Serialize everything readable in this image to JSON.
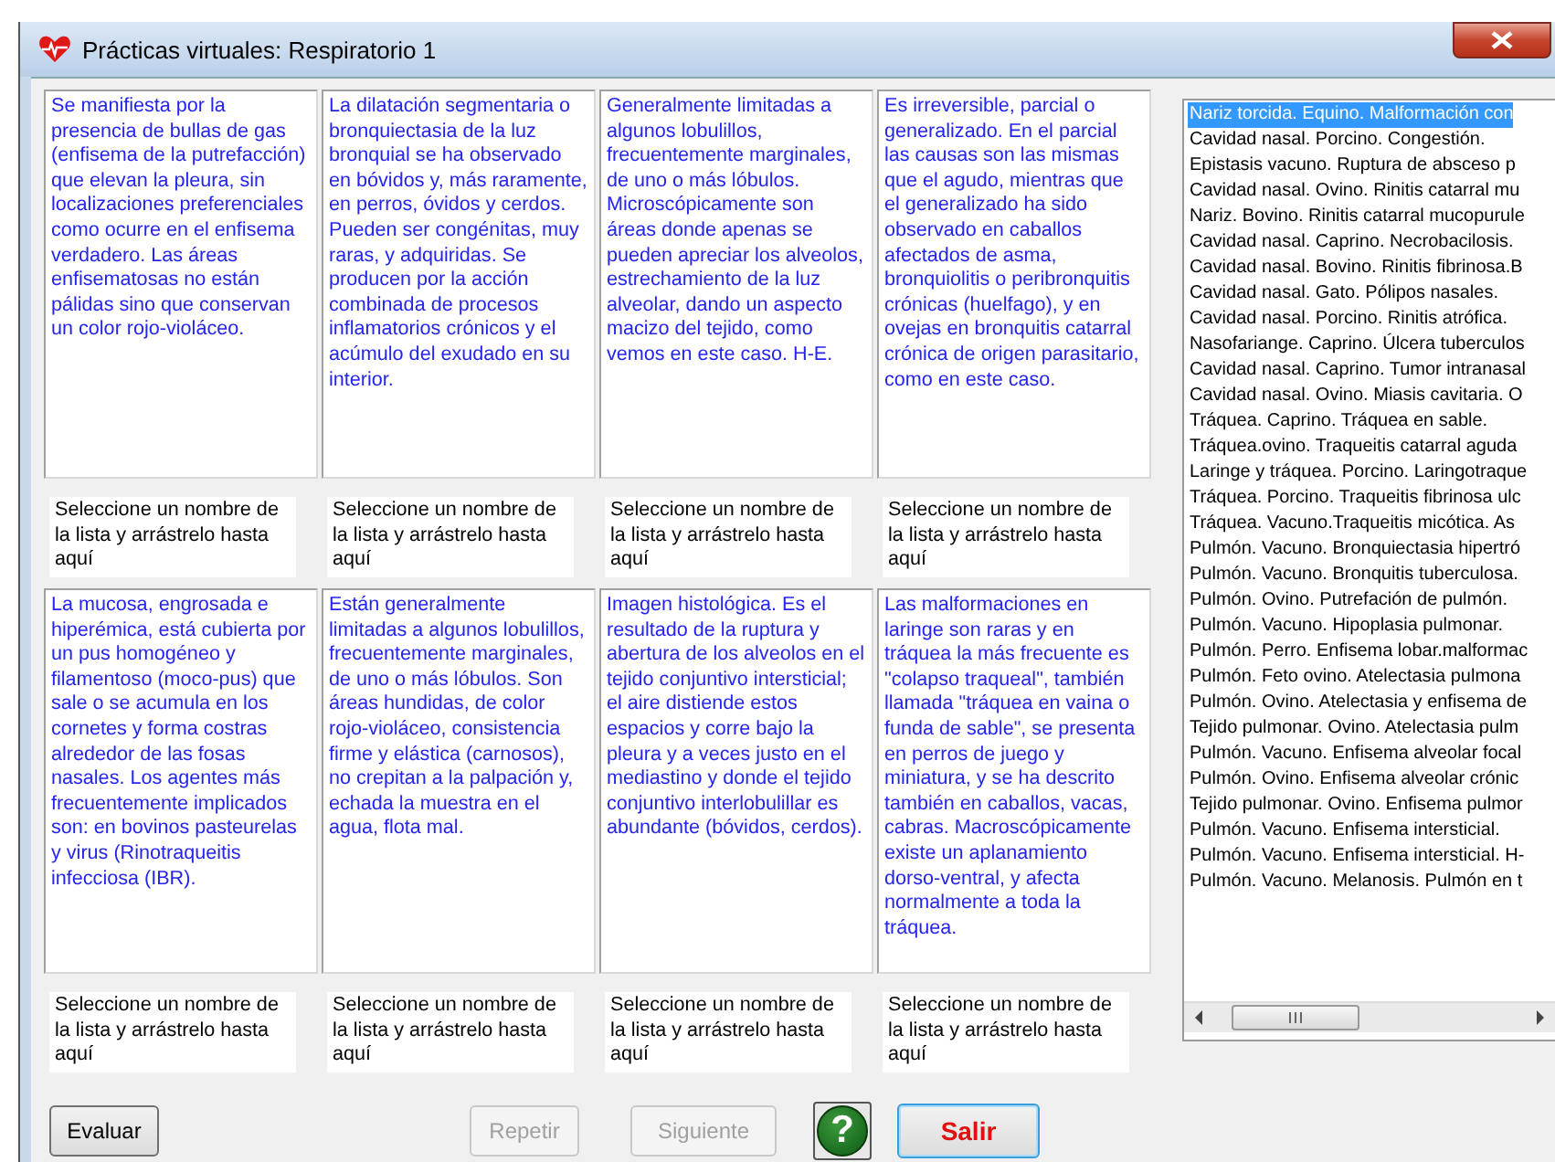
{
  "window": {
    "title": "Prácticas virtuales: Respiratorio 1"
  },
  "rows": [
    {
      "descriptions": [
        "Se manifiesta por la presencia de bullas de gas (enfisema de la putrefacción) que elevan la pleura, sin localizaciones preferenciales como ocurre en el enfisema verdadero. Las áreas enfisematosas no están pálidas sino que conservan un color rojo-violáceo.",
        "La dilatación segmentaria o bronquiectasia de la luz bronquial se ha observado en bóvidos y, más raramente, en perros, óvidos y cerdos. Pueden ser congénitas, muy raras, y adquiridas. Se producen por la acción combinada de procesos inflamatorios crónicos y el acúmulo del exudado en su interior.",
        "Generalmente limitadas a algunos lobulillos, frecuentemente marginales, de uno o más lóbulos. Microscópicamente son áreas donde apenas se pueden apreciar  los alveolos, estrechamiento de la luz alveolar, dando un aspecto macizo del tejido, como vemos en este caso. H-E.",
        "Es irreversible, parcial o generalizado. En el parcial las causas son las mismas que el agudo, mientras que el generalizado ha sido observado en caballos afectados de asma, bronquiolitis o peribronquitis crónicas (huelfago), y en ovejas en bronquitis catarral crónica de origen parasitario, como en este caso."
      ],
      "targets": [
        "Seleccione un nombre de la lista y arrástrelo hasta aquí",
        "Seleccione un nombre de la lista y arrástrelo hasta aquí",
        "Seleccione un nombre de la lista y arrástrelo hasta aquí",
        "Seleccione un nombre de la lista y arrástrelo hasta aquí"
      ]
    },
    {
      "descriptions": [
        "La mucosa, engrosada e hiperémica, está cubierta por un pus homogéneo y filamentoso (moco-pus) que sale o se acumula en los cornetes y forma costras alrededor de las fosas nasales. Los agentes más frecuentemente implicados son: en bovinos pasteurelas y virus (Rinotraqueitis infecciosa (IBR).",
        "Están generalmente limitadas a algunos lobulillos, frecuentemente marginales, de uno o más lóbulos. Son áreas hundidas,  de color rojo-violáceo, consistencia firme y elástica (carnosos), no crepitan a la palpación y, echada la muestra en el agua, flota mal.",
        "Imagen histológica. Es el resultado de la ruptura y abertura de los alveolos en el tejido conjuntivo intersticial;  el aire distiende estos espacios y corre bajo la pleura y a veces justo en el mediastino y donde el tejido conjuntivo interlobulillar es abundante (bóvidos, cerdos).",
        "Las malformaciones en laringe son  raras y en tráquea la más frecuente es  \"colapso traqueal\", también llamada \"tráquea en vaina o funda de sable\",  se presenta en perros de juego y miniatura, y se ha descrito también en caballos, vacas, cabras. Macroscópicamente existe un aplanamiento dorso-ventral, y afecta normalmente a toda la tráquea."
      ],
      "targets": [
        "Seleccione un nombre de la lista y arrástrelo hasta aquí",
        "Seleccione un nombre de la lista y arrástrelo hasta aquí",
        "Seleccione un nombre de la lista y arrástrelo hasta aquí",
        "Seleccione un nombre de la lista y arrástrelo hasta aquí"
      ]
    }
  ],
  "list": {
    "items": [
      {
        "text": "Nariz torcida. Equino. Malformación con",
        "selected": true
      },
      {
        "text": "Cavidad nasal. Porcino. Congestión.",
        "selected": false
      },
      {
        "text": "Epistasis vacuno. Ruptura de absceso p",
        "selected": false
      },
      {
        "text": "Cavidad nasal. Ovino. Rinitis catarral mu",
        "selected": false
      },
      {
        "text": "Nariz. Bovino. Rinitis catarral mucopurule",
        "selected": false
      },
      {
        "text": "Cavidad nasal. Caprino. Necrobacilosis.",
        "selected": false
      },
      {
        "text": "Cavidad nasal. Bovino. Rinitis fibrinosa.B",
        "selected": false
      },
      {
        "text": "Cavidad nasal. Gato. Pólipos nasales.",
        "selected": false
      },
      {
        "text": "Cavidad nasal. Porcino. Rinitis atrófica.",
        "selected": false
      },
      {
        "text": "Nasofariange. Caprino. Úlcera tuberculos",
        "selected": false
      },
      {
        "text": "Cavidad nasal. Caprino. Tumor intranasal",
        "selected": false
      },
      {
        "text": "Cavidad nasal. Ovino. Miasis cavitaria. O",
        "selected": false
      },
      {
        "text": "Tráquea. Caprino. Tráquea en sable.",
        "selected": false
      },
      {
        "text": "Tráquea.ovino. Traqueitis catarral aguda",
        "selected": false
      },
      {
        "text": "Laringe y tráquea. Porcino. Laringotraque",
        "selected": false
      },
      {
        "text": "Tráquea. Porcino. Traqueitis fibrinosa ulc",
        "selected": false
      },
      {
        "text": "Tráquea. Vacuno.Traqueitis micótica. As",
        "selected": false
      },
      {
        "text": "Pulmón. Vacuno. Bronquiectasia hipertró",
        "selected": false
      },
      {
        "text": "Pulmón. Vacuno. Bronquitis tuberculosa.",
        "selected": false
      },
      {
        "text": "Pulmón. Ovino. Putrefación de pulmón.",
        "selected": false
      },
      {
        "text": "Pulmón. Vacuno. Hipoplasia pulmonar.",
        "selected": false
      },
      {
        "text": "Pulmón. Perro. Enfisema lobar.malformac",
        "selected": false
      },
      {
        "text": "Pulmón. Feto ovino. Atelectasia pulmona",
        "selected": false
      },
      {
        "text": "Pulmón. Ovino. Atelectasia y enfisema de",
        "selected": false
      },
      {
        "text": "Tejido pulmonar. Ovino. Atelectasia pulm",
        "selected": false
      },
      {
        "text": "Pulmón. Vacuno. Enfisema alveolar focal",
        "selected": false
      },
      {
        "text": "Pulmón. Ovino. Enfisema alveolar crónic",
        "selected": false
      },
      {
        "text": "Tejido pulmonar. Ovino. Enfisema pulmor",
        "selected": false
      },
      {
        "text": "Pulmón. Vacuno. Enfisema intersticial.",
        "selected": false
      },
      {
        "text": "Pulmón. Vacuno. Enfisema intersticial. H-",
        "selected": false
      },
      {
        "text": "Pulmón. Vacuno. Melanosis. Pulmón en t",
        "selected": false
      }
    ]
  },
  "buttons": [
    {
      "kind": "normal",
      "label": "Evaluar",
      "disabled": false
    },
    {
      "kind": "normal",
      "label": "Repetir",
      "disabled": true
    },
    {
      "kind": "normal",
      "label": "Siguiente",
      "disabled": true
    },
    {
      "kind": "help",
      "label": "?",
      "disabled": false
    },
    {
      "kind": "exit",
      "label": "Salir",
      "disabled": false
    }
  ]
}
